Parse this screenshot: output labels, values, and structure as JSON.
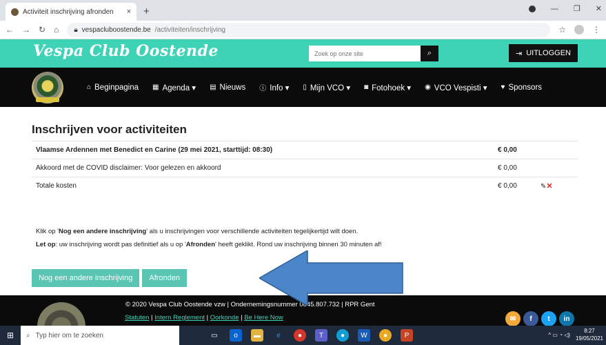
{
  "browser": {
    "tab_title": "Activiteit inschrijving afronden",
    "tab_close": "×",
    "new_tab": "+",
    "url_domain": "vespacluboostende.be",
    "url_path": "/activiteiten/inschrijving"
  },
  "site": {
    "logo": "Vespa Club Oostende",
    "search_placeholder": "Zoek op onze site",
    "logout_label": "UITLOGGEN",
    "nav": [
      {
        "icon": "home-icon",
        "glyph": "⌂",
        "label": "Beginpagina"
      },
      {
        "icon": "calendar-icon",
        "glyph": "▦",
        "label": "Agenda ▾"
      },
      {
        "icon": "newspaper-icon",
        "glyph": "▤",
        "label": "Nieuws"
      },
      {
        "icon": "info-icon",
        "glyph": "ⓘ",
        "label": "Info ▾"
      },
      {
        "icon": "document-icon",
        "glyph": "▯",
        "label": "Mijn VCO ▾"
      },
      {
        "icon": "camera-icon",
        "glyph": "◙",
        "label": "Fotohoek ▾"
      },
      {
        "icon": "location-icon",
        "glyph": "◉",
        "label": "VCO Vespisti ▾"
      },
      {
        "icon": "heart-icon",
        "glyph": "♥",
        "label": "Sponsors"
      }
    ]
  },
  "main": {
    "title": "Inschrijven voor activiteiten",
    "rows": [
      {
        "label": "Vlaamse Ardennen met Benedict en Carine (29 mei 2021, starttijd: 08:30)",
        "price": "€ 0,00",
        "bold": true
      },
      {
        "label": "Akkoord met de COVID disclaimer: Voor gelezen en akkoord",
        "price": "€ 0,00",
        "bold": false
      },
      {
        "label": "Totale kosten",
        "price": "€ 0,00",
        "bold": false
      }
    ],
    "info_line1_pre": "Klik op '",
    "info_line1_bold": "Nog een andere inschrijving",
    "info_line1_post": "' als u inschrijvingen voor verschillende activiteiten tegelijkertijd wilt doen.",
    "info_line2_bold1": "Let op",
    "info_line2_mid": ": uw inschrijving wordt pas definitief als u op '",
    "info_line2_bold2": "Afronden",
    "info_line2_post": "' heeft geklikt. Rond uw inschrijving binnen 30 minuten af!",
    "btn_another": "Nog een andere inschrijving",
    "btn_finish": "Afronden"
  },
  "footer": {
    "copyright": "© 2020 Vespa Club Oostende vzw | Ondernemingsnummer 0845.807.732 | RPR Gent",
    "links": [
      "Statuten",
      "Intern Reglement",
      "Oorkonde",
      "Be Here Now"
    ],
    "social": [
      "✉",
      "f",
      "t",
      "in"
    ]
  },
  "taskbar": {
    "search_placeholder": "Typ hier om te zoeken",
    "time": "8:27",
    "date": "19/05/2021"
  },
  "colors": {
    "accent": "#3ed3b7",
    "button": "#5ac5b2",
    "arrow": "#4a86c8"
  }
}
